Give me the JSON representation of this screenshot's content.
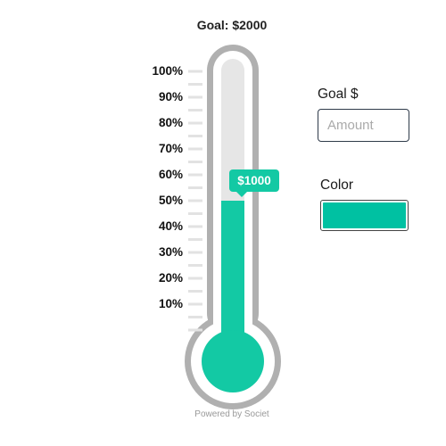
{
  "goal_title": "Goal: $2000",
  "thermometer": {
    "goal_amount": 2000,
    "current_amount": 1000,
    "fill_fraction": 0.5,
    "bubble_label": "$1000",
    "scale_labels": [
      "100%",
      "90%",
      "80%",
      "70%",
      "60%",
      "50%",
      "40%",
      "30%",
      "20%",
      "10%"
    ],
    "fill_color": "#13c9a4",
    "tube_color": "#e6e6e6",
    "outline_color": "#b0b0b0"
  },
  "powered_by": "Powered by Societ",
  "form": {
    "goal_label": "Goal $",
    "amount_placeholder": "Amount",
    "color_label": "Color",
    "color_value": "#00c1a2"
  }
}
